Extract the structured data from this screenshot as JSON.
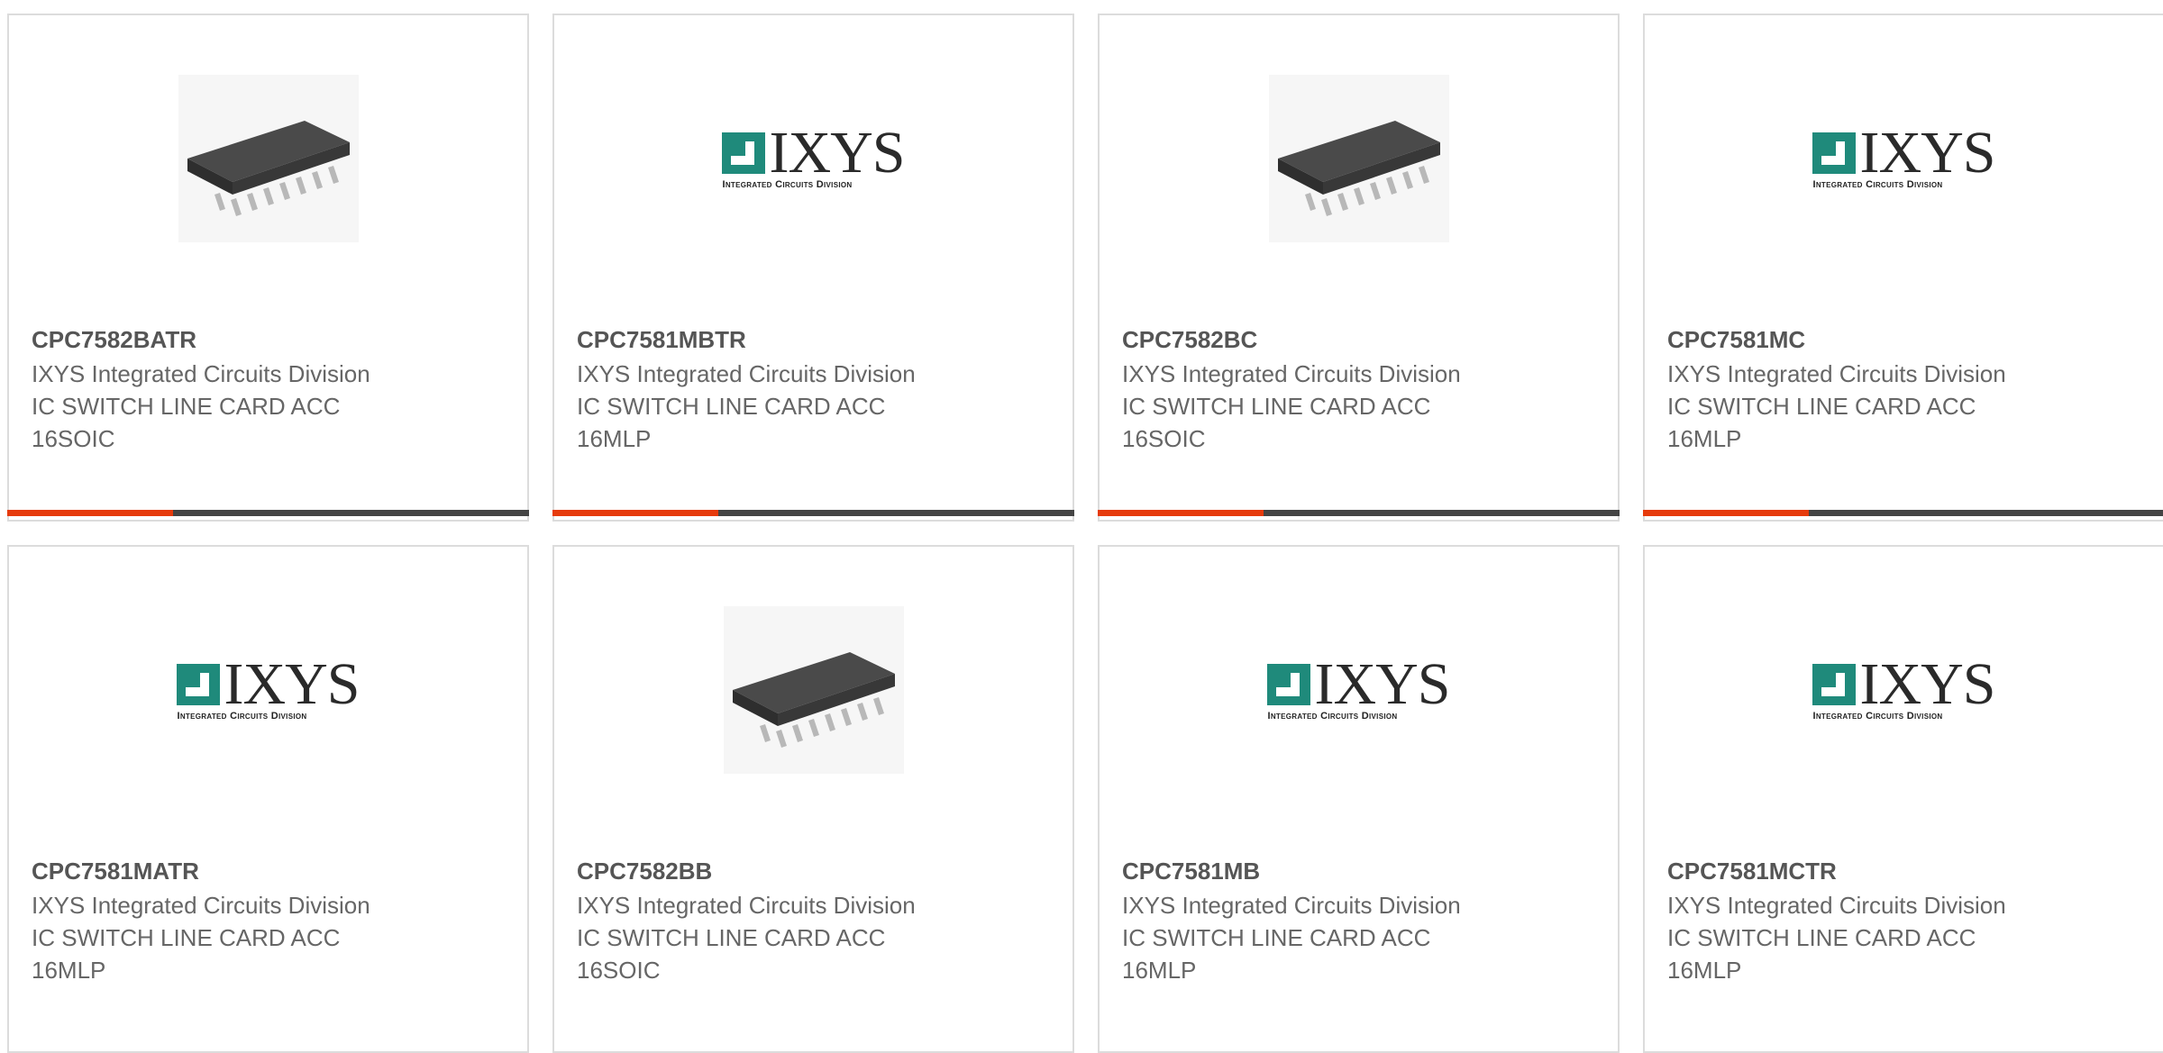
{
  "products": [
    {
      "part": "CPC7582BATR",
      "maker": "IXYS Integrated Circuits Division",
      "desc": "IC SWITCH LINE CARD ACC",
      "pkg": "16SOIC",
      "image": "soic-chip"
    },
    {
      "part": "CPC7581MBTR",
      "maker": "IXYS Integrated Circuits Division",
      "desc": "IC SWITCH LINE CARD ACC",
      "pkg": "16MLP",
      "image": "ixys-logo"
    },
    {
      "part": "CPC7582BC",
      "maker": "IXYS Integrated Circuits Division",
      "desc": "IC SWITCH LINE CARD ACC",
      "pkg": "16SOIC",
      "image": "soic-chip"
    },
    {
      "part": "CPC7581MC",
      "maker": "IXYS Integrated Circuits Division",
      "desc": "IC SWITCH LINE CARD ACC",
      "pkg": "16MLP",
      "image": "ixys-logo"
    },
    {
      "part": "CPC7581MATR",
      "maker": "IXYS Integrated Circuits Division",
      "desc": "IC SWITCH LINE CARD ACC",
      "pkg": "16MLP",
      "image": "ixys-logo"
    },
    {
      "part": "CPC7582BB",
      "maker": "IXYS Integrated Circuits Division",
      "desc": "IC SWITCH LINE CARD ACC",
      "pkg": "16SOIC",
      "image": "soic-chip"
    },
    {
      "part": "CPC7581MB",
      "maker": "IXYS Integrated Circuits Division",
      "desc": "IC SWITCH LINE CARD ACC",
      "pkg": "16MLP",
      "image": "ixys-logo"
    },
    {
      "part": "CPC7581MCTR",
      "maker": "IXYS Integrated Circuits Division",
      "desc": "IC SWITCH LINE CARD ACC",
      "pkg": "16MLP",
      "image": "ixys-logo"
    }
  ],
  "logo": {
    "word": "IXYS",
    "sub": "Integrated Circuits Division"
  },
  "colors": {
    "accent": "#e63b0c",
    "bar": "#444444",
    "logo_teal": "#1f8a7b"
  }
}
